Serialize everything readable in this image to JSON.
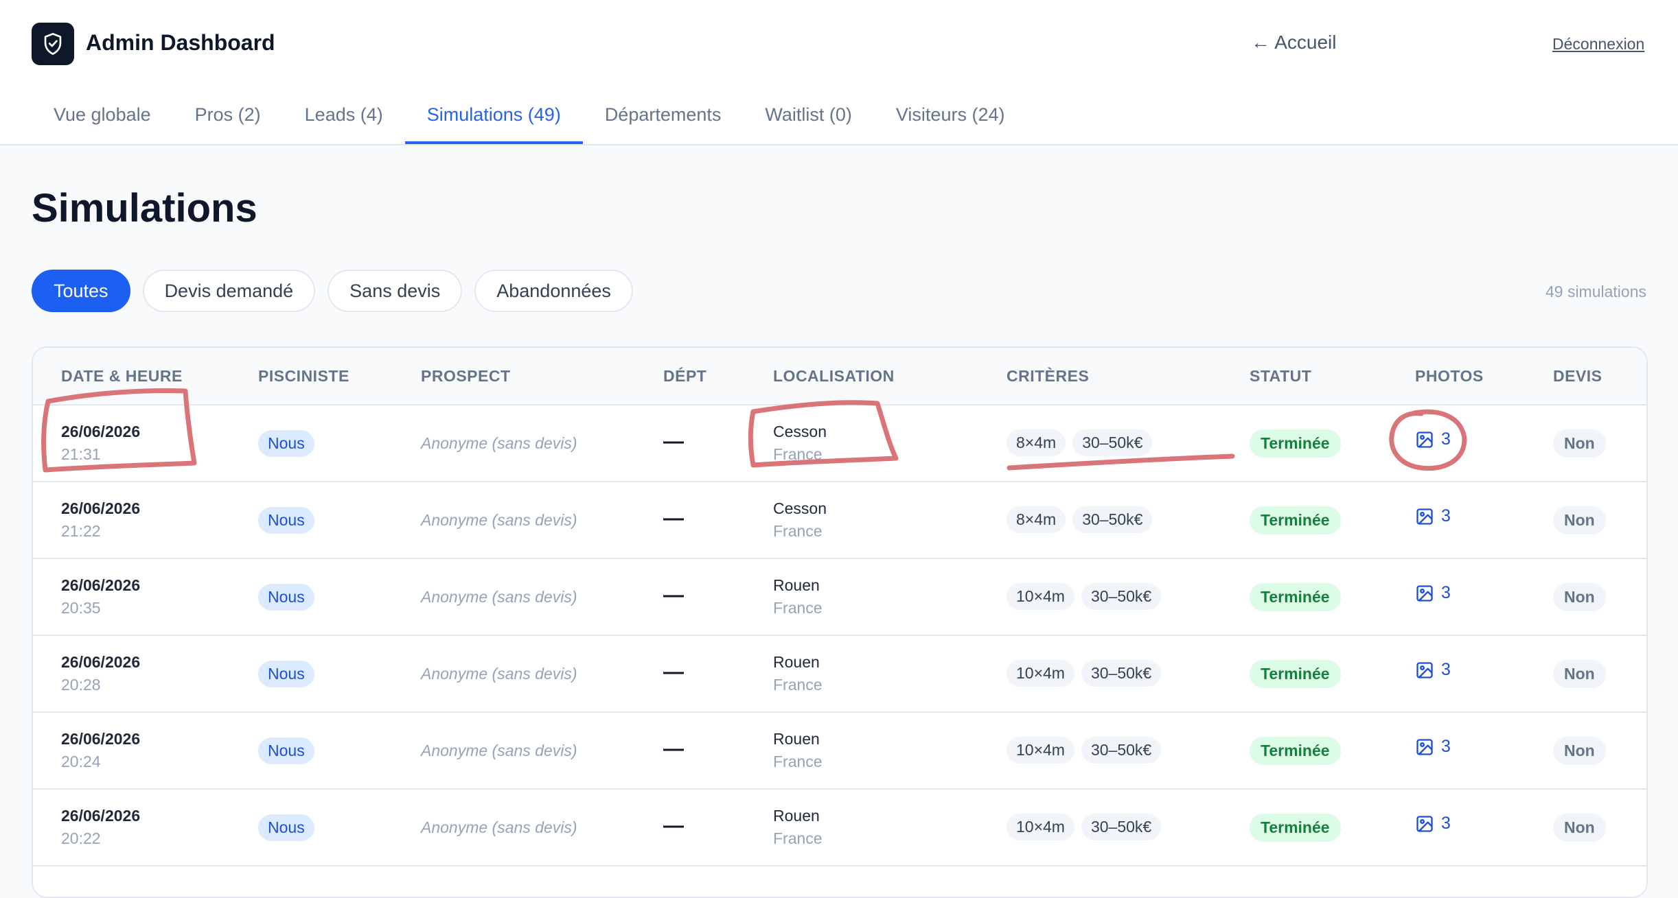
{
  "header": {
    "app_title": "Admin Dashboard",
    "home_link": "← Accueil",
    "logout_link": "Déconnexion",
    "logo_icon": "shield-check-icon"
  },
  "tabs": [
    {
      "label": "Vue globale"
    },
    {
      "label": "Pros (2)"
    },
    {
      "label": "Leads (4)"
    },
    {
      "label": "Simulations (49)",
      "active": true
    },
    {
      "label": "Départements"
    },
    {
      "label": "Waitlist (0)"
    },
    {
      "label": "Visiteurs (24)"
    }
  ],
  "page": {
    "title": "Simulations",
    "count_text": "49 simulations"
  },
  "filters": [
    {
      "label": "Toutes",
      "active": true
    },
    {
      "label": "Devis demandé"
    },
    {
      "label": "Sans devis"
    },
    {
      "label": "Abandonnées"
    }
  ],
  "table": {
    "columns": [
      "Date & heure",
      "Pisciniste",
      "Prospect",
      "Dépt",
      "Localisation",
      "Critères",
      "Statut",
      "Photos",
      "Devis"
    ],
    "rows": [
      {
        "date": "26/06/2026",
        "time": "21:31",
        "pisciniste": "Nous",
        "prospect": "Anonyme (sans devis)",
        "dept": "—",
        "city": "Cesson",
        "country": "France",
        "size": "8×4m",
        "budget": "30–50k€",
        "status": "Terminée",
        "photos": "3",
        "devis": "Non"
      },
      {
        "date": "26/06/2026",
        "time": "21:22",
        "pisciniste": "Nous",
        "prospect": "Anonyme (sans devis)",
        "dept": "—",
        "city": "Cesson",
        "country": "France",
        "size": "8×4m",
        "budget": "30–50k€",
        "status": "Terminée",
        "photos": "3",
        "devis": "Non"
      },
      {
        "date": "26/06/2026",
        "time": "20:35",
        "pisciniste": "Nous",
        "prospect": "Anonyme (sans devis)",
        "dept": "—",
        "city": "Rouen",
        "country": "France",
        "size": "10×4m",
        "budget": "30–50k€",
        "status": "Terminée",
        "photos": "3",
        "devis": "Non"
      },
      {
        "date": "26/06/2026",
        "time": "20:28",
        "pisciniste": "Nous",
        "prospect": "Anonyme (sans devis)",
        "dept": "—",
        "city": "Rouen",
        "country": "France",
        "size": "10×4m",
        "budget": "30–50k€",
        "status": "Terminée",
        "photos": "3",
        "devis": "Non"
      },
      {
        "date": "26/06/2026",
        "time": "20:24",
        "pisciniste": "Nous",
        "prospect": "Anonyme (sans devis)",
        "dept": "—",
        "city": "Rouen",
        "country": "France",
        "size": "10×4m",
        "budget": "30–50k€",
        "status": "Terminée",
        "photos": "3",
        "devis": "Non"
      },
      {
        "date": "26/06/2026",
        "time": "20:22",
        "pisciniste": "Nous",
        "prospect": "Anonyme (sans devis)",
        "dept": "—",
        "city": "Rouen",
        "country": "France",
        "size": "10×4m",
        "budget": "30–50k€",
        "status": "Terminée",
        "photos": "3",
        "devis": "Non"
      }
    ]
  },
  "colors": {
    "accent": "#1d5ff0",
    "status_green": "#15803d",
    "annotation_red": "#d97479"
  }
}
